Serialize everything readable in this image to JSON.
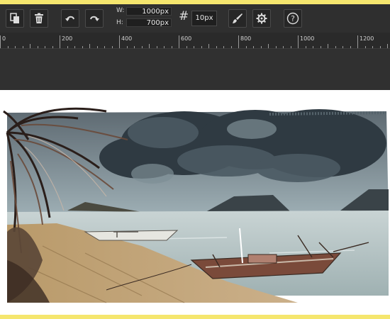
{
  "toolbar": {
    "buttons": [
      {
        "name": "copy-button",
        "icon": "copy-icon"
      },
      {
        "name": "delete-button",
        "icon": "trash-icon"
      },
      {
        "name": "undo-button",
        "icon": "undo-icon"
      },
      {
        "name": "redo-button",
        "icon": "redo-icon"
      }
    ],
    "width_label": "W:",
    "width_value": "1000px",
    "height_label": "H:",
    "height_value": "700px",
    "grid_symbol": "#",
    "grid_value": "10px",
    "tool_icons": [
      "brush-icon",
      "gear-icon",
      "help-icon"
    ],
    "help_symbol": "?"
  },
  "ruler": {
    "labels": [
      "0",
      "200",
      "400",
      "600",
      "800",
      "1000",
      "1200"
    ]
  },
  "colors": {
    "toolbar_bg": "#2f2f2f",
    "frame_border": "#f5e66e",
    "canvas_bg": "#ffffff"
  }
}
